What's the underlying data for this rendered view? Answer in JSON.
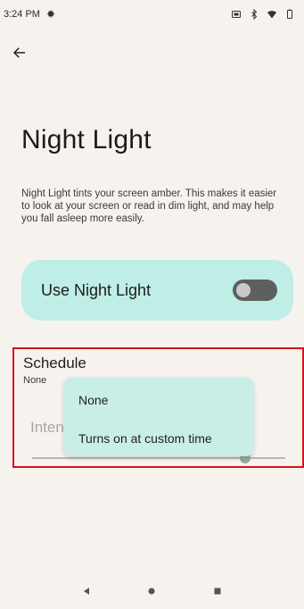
{
  "status_bar": {
    "time": "3:24 PM",
    "icons": [
      "gear-icon",
      "cast-icon",
      "bluetooth-icon",
      "wifi-icon",
      "battery-icon"
    ]
  },
  "header": {
    "back_icon": "arrow-left-icon",
    "title": "Night Light",
    "description": "Night Light tints your screen amber. This makes it easier to look at your screen or read in dim light, and may help you fall asleep more easily."
  },
  "toggle_card": {
    "label": "Use Night Light",
    "state": "off",
    "accent": "#bfeee6"
  },
  "schedule": {
    "title": "Schedule",
    "value": "None",
    "intensity_label": "Intensity"
  },
  "dropdown": {
    "options": [
      "None",
      "Turns on at custom time"
    ]
  },
  "highlight_color": "#d80f1a",
  "nav": {
    "icons": [
      "back-triangle-icon",
      "home-circle-icon",
      "recents-square-icon"
    ]
  }
}
